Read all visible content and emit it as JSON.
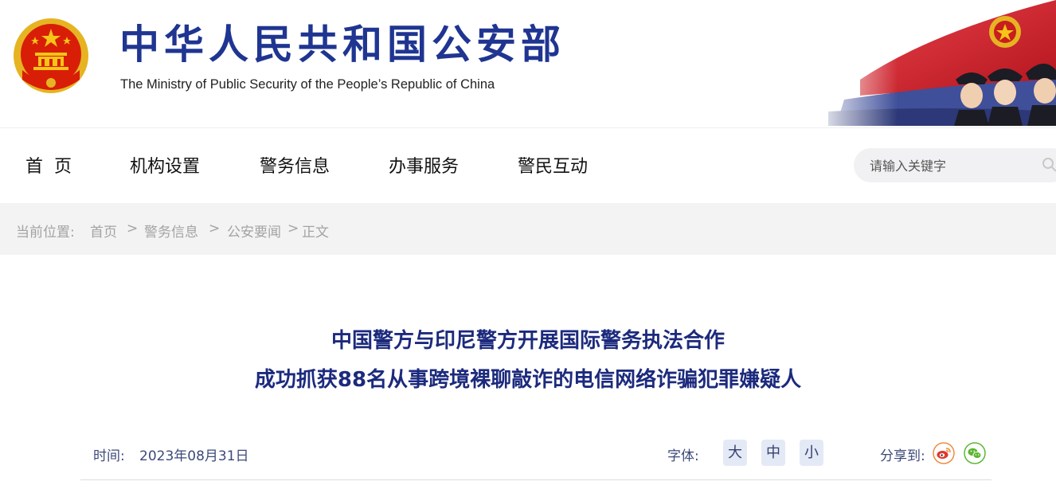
{
  "header": {
    "title_cn": "中华人民共和国公安部",
    "title_en": "The Ministry of Public Security of the People’s Republic of China",
    "emblem_icon": "national-emblem-icon",
    "banner_icon": "police-flag-banner-icon",
    "brand_color": "#1f3591"
  },
  "nav": {
    "items": [
      {
        "label": "首  页"
      },
      {
        "label": "机构设置"
      },
      {
        "label": "警务信息"
      },
      {
        "label": "办事服务"
      },
      {
        "label": "警民互动"
      }
    ],
    "search_placeholder": "请输入关键字",
    "search_icon": "search-icon"
  },
  "breadcrumb": {
    "prefix": "当前位置:",
    "items": [
      "首页",
      "警务信息",
      "公安要闻",
      "正文"
    ],
    "separator": ">"
  },
  "article": {
    "title_line1": "中国警方与印尼警方开展国际警务执法合作",
    "title_line2": "成功抓获88名从事跨境裸聊敲诈的电信网络诈骗犯罪嫌疑人",
    "title_color": "#1c2a7d",
    "time_label": "时间:",
    "date": "2023年08月31日",
    "font_size_label": "字体:",
    "font_sizes": [
      "大",
      "中",
      "小"
    ],
    "share_label": "分享到:",
    "share_icons": [
      "weibo-icon",
      "wechat-icon"
    ]
  }
}
